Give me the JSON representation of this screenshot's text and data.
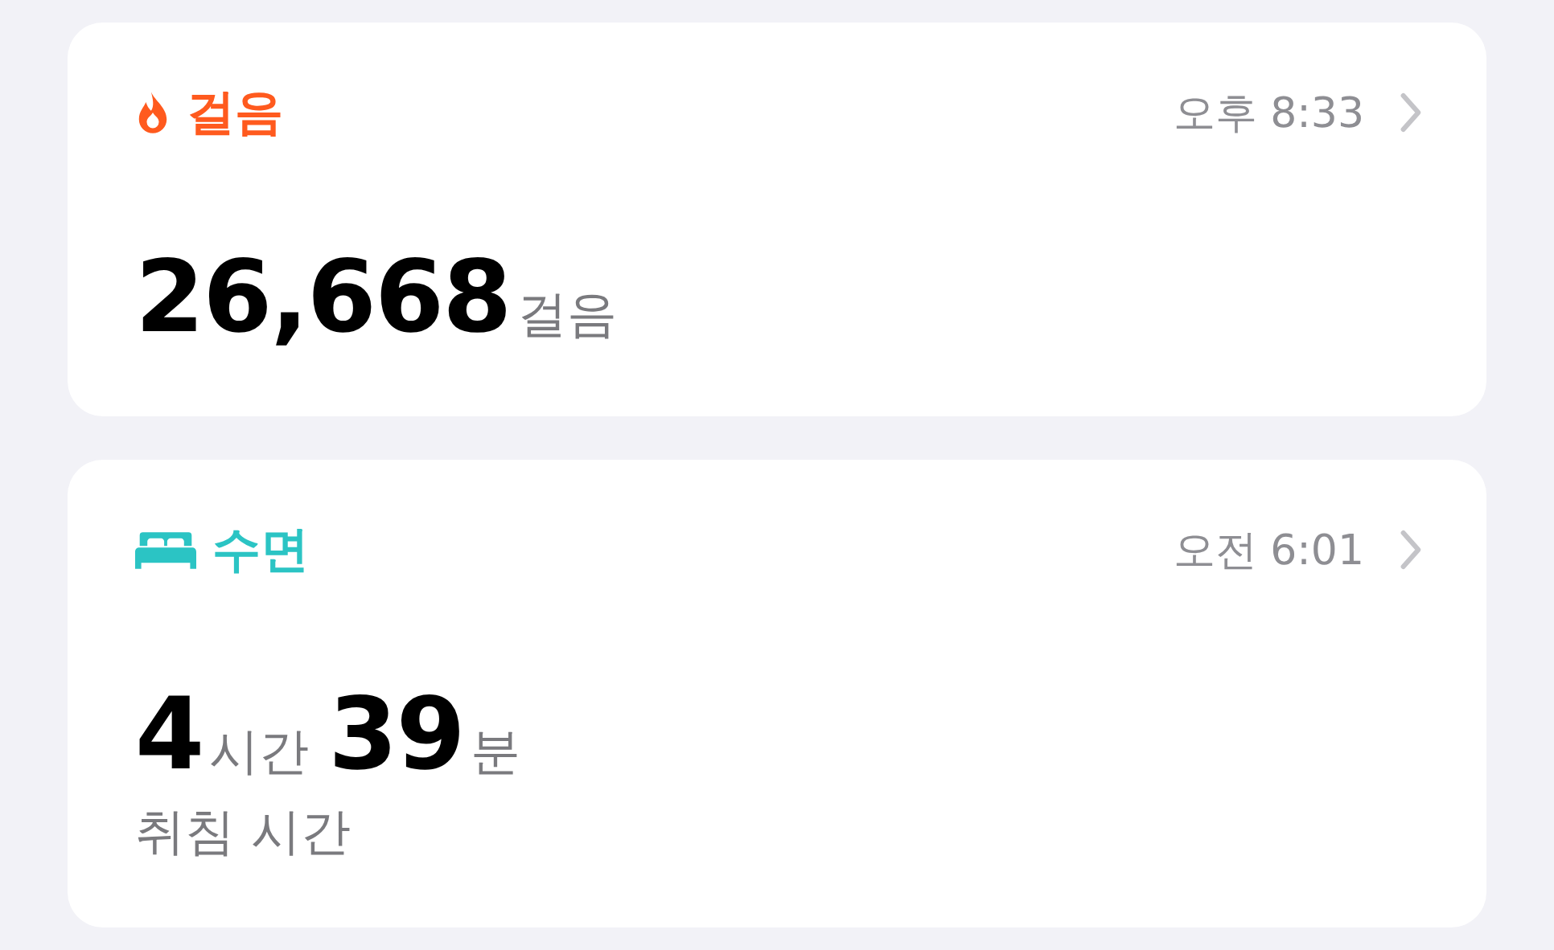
{
  "cards": [
    {
      "kind": "steps",
      "title": "걸음",
      "color": "#ff5a1e",
      "time": "오후 8:33",
      "values": [
        {
          "number": "26,668",
          "unit": "걸음"
        }
      ]
    },
    {
      "kind": "sleep",
      "title": "수면",
      "color": "#2bc4c4",
      "time": "오전 6:01",
      "values": [
        {
          "number": "4",
          "unit": "시간"
        },
        {
          "number": "39",
          "unit": "분"
        }
      ],
      "caption": "취침 시간"
    }
  ]
}
